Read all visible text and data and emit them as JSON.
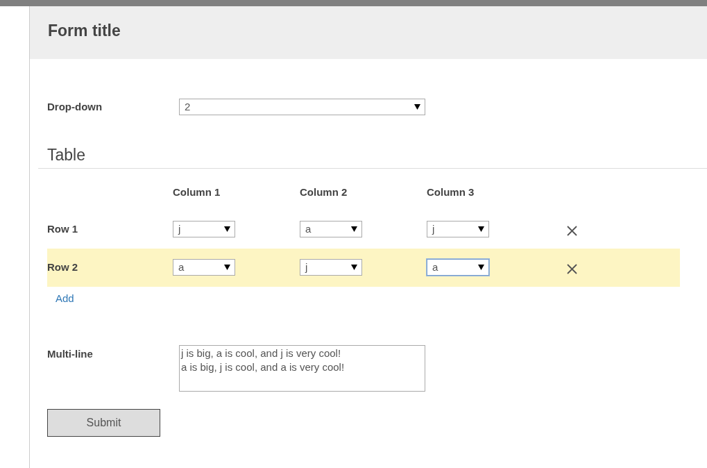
{
  "form": {
    "title": "Form title"
  },
  "dropdown": {
    "label": "Drop-down",
    "value": "2"
  },
  "table": {
    "heading": "Table",
    "columns": [
      "Column 1",
      "Column 2",
      "Column 3"
    ],
    "rows": [
      {
        "label": "Row 1",
        "selected": false,
        "cells": [
          {
            "value": "j",
            "focused": false
          },
          {
            "value": "a",
            "focused": false
          },
          {
            "value": "j",
            "focused": false
          }
        ]
      },
      {
        "label": "Row 2",
        "selected": true,
        "cells": [
          {
            "value": "a",
            "focused": false
          },
          {
            "value": "j",
            "focused": false
          },
          {
            "value": "a",
            "focused": true
          }
        ]
      }
    ],
    "add_link": "Add"
  },
  "multiline": {
    "label": "Multi-line",
    "value": "j is big, a is cool, and j is very cool!\na is big, j is cool, and a is very cool!"
  },
  "submit": "Submit"
}
